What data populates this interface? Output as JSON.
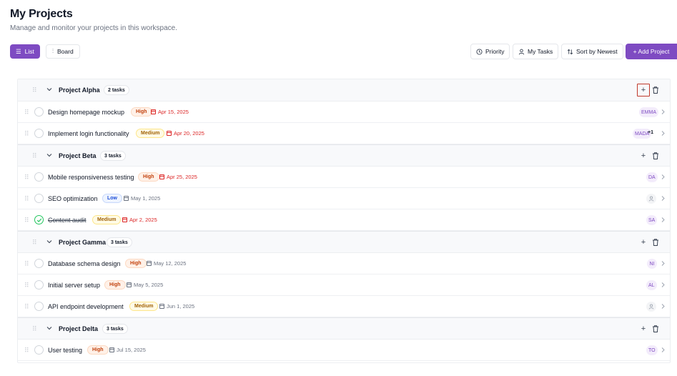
{
  "header": {
    "title": "My Projects",
    "subtitle": "Manage and monitor your projects in this workspace."
  },
  "views": {
    "list_label": "List",
    "board_label": "Board",
    "active": "List"
  },
  "toolbar": {
    "priority_label": "Priority",
    "my_tasks_label": "My Tasks",
    "sort_label": "Sort by Newest",
    "add_project_label": "+ Add Project"
  },
  "colors": {
    "accent": "#7e4bc2",
    "high": "#c2410c",
    "medium": "#a16207",
    "low": "#1d4ed8",
    "overdue": "#dc2626",
    "done": "#22c55e"
  },
  "projects": [
    {
      "name": "Project Alpha",
      "count": "2 tasks",
      "tasks": [
        {
          "title": "Design homepage mockup",
          "priority": "High",
          "date": "Apr 15, 2025",
          "assignee": "EMMA",
          "extra": ""
        },
        {
          "title": "Implement login functionality",
          "priority": "Medium",
          "date": "Apr 20, 2025",
          "assignee": "MADA",
          "extra": "+1"
        }
      ]
    },
    {
      "name": "Project Beta",
      "count": "3 tasks",
      "tasks": [
        {
          "title": "Mobile responsiveness testing",
          "priority": "High",
          "date": "Apr 25, 2025",
          "assignee": "DA",
          "extra": ""
        },
        {
          "title": "SEO optimization",
          "priority": "Low",
          "date": "May 1, 2025",
          "assignee": "",
          "extra": ""
        },
        {
          "title": "Content audit",
          "priority": "Medium",
          "date": "Apr 2, 2025",
          "assignee": "SA",
          "extra": "",
          "completed": true
        }
      ]
    },
    {
      "name": "Project Gamma",
      "count": "3 tasks",
      "tasks": [
        {
          "title": "Database schema design",
          "priority": "High",
          "date": "May 12, 2025",
          "assignee": "NI",
          "extra": ""
        },
        {
          "title": "Initial server setup",
          "priority": "High",
          "date": "May 5, 2025",
          "assignee": "AL",
          "extra": ""
        },
        {
          "title": "API endpoint development",
          "priority": "Medium",
          "date": "Jun 1, 2025",
          "assignee": "",
          "extra": ""
        }
      ]
    },
    {
      "name": "Project Delta",
      "count": "3 tasks",
      "tasks": [
        {
          "title": "User testing",
          "priority": "High",
          "date": "Jul 15, 2025",
          "assignee": "TO",
          "extra": ""
        }
      ]
    }
  ]
}
